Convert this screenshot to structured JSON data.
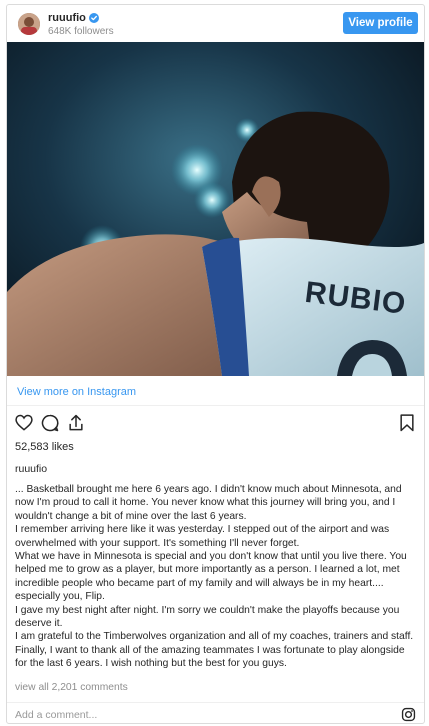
{
  "header": {
    "username": "ruuufio",
    "followers": "648K followers",
    "view_profile_label": "View profile"
  },
  "post": {
    "jersey_text": "RUBIO",
    "view_more_label": "View more on Instagram",
    "likes": "52,583 likes",
    "username": "ruuufio",
    "caption": [
      "... Basketball brought me here 6 years ago. I didn't know much about Minnesota, and now I'm proud to call it home. You never know what this journey will bring you, and I wouldn't change a bit of mine over the last 6 years.",
      "I remember arriving here like it was yesterday. I stepped out of the airport and was overwhelmed with your support. It's something I'll never forget.",
      "What we have in Minnesota is special and you don't know that until you live there. You helped me to grow as a player, but more importantly as a person. I learned a lot, met incredible people who became part of my family and will always be in my heart.... especially you, Flip.",
      "I gave my best night after night. I'm sorry we couldn't make the playoffs because you deserve it.",
      "I am grateful to the Timberwolves organization and all of my coaches, trainers and staff. Finally, I want to thank all of the amazing teammates I was fortunate to play alongside for the last 6 years. I wish nothing but the best for you guys."
    ],
    "view_comments_label": "view all 2,201 comments",
    "add_comment_placeholder": "Add a comment..."
  },
  "colors": {
    "accent": "#3897f0",
    "text": "#262626",
    "muted": "#8e8e8e",
    "border": "#dbdbdb"
  },
  "icons": [
    "heart-icon",
    "comment-icon",
    "share-icon",
    "bookmark-icon",
    "instagram-icon",
    "verified-badge-icon"
  ]
}
